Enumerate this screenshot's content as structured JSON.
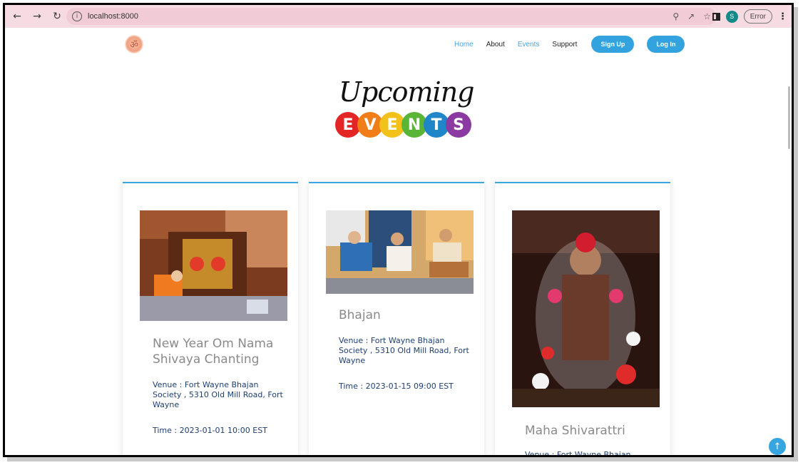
{
  "browser": {
    "url": "localhost:8000",
    "profile_initial": "S",
    "error_label": "Error",
    "icons": [
      "back-icon",
      "forward-icon",
      "reload-icon",
      "info-icon",
      "zoom-icon",
      "share-icon",
      "star-icon",
      "side-panel-icon",
      "menu-icon"
    ]
  },
  "site": {
    "nav": {
      "home": "Home",
      "about": "About",
      "events": "Events",
      "support": "Support",
      "signup": "Sign Up",
      "login": "Log In"
    },
    "hero": {
      "script": "Upcoming",
      "letters": [
        "E",
        "V",
        "E",
        "N",
        "T",
        "S"
      ],
      "colors": [
        "#e32525",
        "#f07d17",
        "#f2c21a",
        "#5ab537",
        "#1e86c9",
        "#8a3aa0"
      ]
    }
  },
  "events": [
    {
      "title": "New Year Om Nama Shivaya Chanting",
      "venue": "Venue : Fort Wayne Bhajan Society , 5310 Old Mill Road, Fort Wayne",
      "time": "Time : 2023-01-01 10:00 EST"
    },
    {
      "title": "Bhajan",
      "venue": "Venue : Fort Wayne Bhajan Society , 5310 Old Mill Road, Fort Wayne",
      "time": "Time : 2023-01-15 09:00 EST"
    },
    {
      "title": "Maha Shivarattri",
      "venue": "Venue : Fort Wayne Bhajan",
      "time": ""
    }
  ],
  "colors": {
    "accent": "#33a3df",
    "toolbar": "#f7dbe3",
    "venue_text": "#1f3f72",
    "title_text": "#8a8a8a"
  }
}
